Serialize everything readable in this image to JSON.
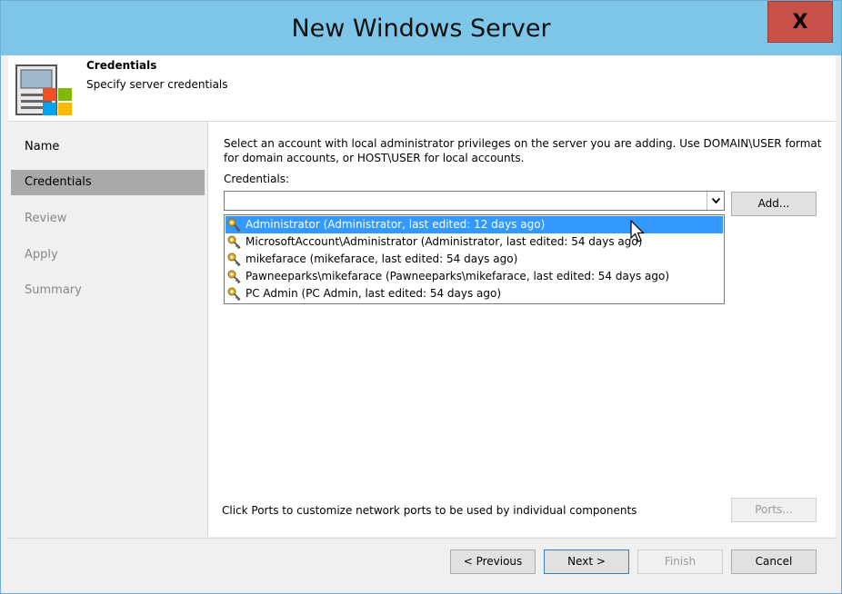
{
  "window": {
    "title": "New Windows Server",
    "close_label": "X"
  },
  "header": {
    "title": "Credentials",
    "subtitle": "Specify server credentials",
    "icon": "windows-server-icon"
  },
  "nav": {
    "items": [
      {
        "label": "Name",
        "state": "done"
      },
      {
        "label": "Credentials",
        "state": "active"
      },
      {
        "label": "Review",
        "state": "pending"
      },
      {
        "label": "Apply",
        "state": "pending"
      },
      {
        "label": "Summary",
        "state": "pending"
      }
    ]
  },
  "main": {
    "instructions": "Select an account with local administrator privileges on the server you are adding. Use DOMAIN\\USER format for domain accounts, or HOST\\USER for local accounts.",
    "credentials_label": "Credentials:",
    "combo_value": "",
    "add_label": "Add...",
    "credential_options": [
      {
        "label": "Administrator (Administrator, last edited: 12 days ago)",
        "selected": true
      },
      {
        "label": "MicrosoftAccount\\Administrator (Administrator, last edited: 54 days ago)",
        "selected": false
      },
      {
        "label": "mikefarace (mikefarace, last edited: 54 days ago)",
        "selected": false
      },
      {
        "label": "Pawneeparks\\mikefarace (Pawneeparks\\mikefarace, last edited: 54 days ago)",
        "selected": false
      },
      {
        "label": "PC Admin (PC Admin, last edited: 54 days ago)",
        "selected": false
      }
    ],
    "ports_text": "Click Ports to customize network ports to be used by individual components",
    "ports_label": "Ports..."
  },
  "footer": {
    "previous_label": "< Previous",
    "next_label": "Next >",
    "finish_label": "Finish",
    "cancel_label": "Cancel"
  },
  "colors": {
    "titlebar": "#7ec6e8",
    "close_button": "#c7504b",
    "selection": "#3399ff",
    "nav_active": "#a9a9a9"
  }
}
